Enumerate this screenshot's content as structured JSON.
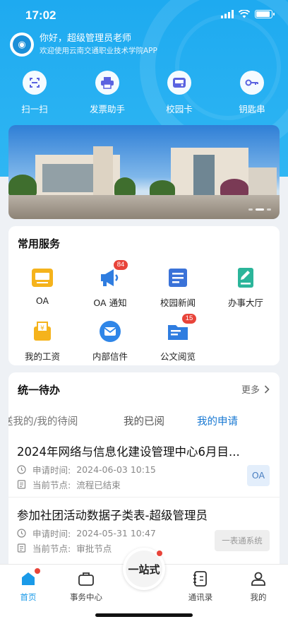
{
  "status": {
    "time": "17:02"
  },
  "header": {
    "greeting": "你好，超级管理员老师",
    "welcome": "欢迎使用云南交通职业技术学院APP"
  },
  "quick_actions": [
    {
      "label": "扫一扫",
      "icon": "scan-icon"
    },
    {
      "label": "发票助手",
      "icon": "printer-icon"
    },
    {
      "label": "校园卡",
      "icon": "card-icon"
    },
    {
      "label": "钥匙串",
      "icon": "key-icon"
    }
  ],
  "banner": {
    "slides": 3,
    "active": 2
  },
  "services": {
    "title": "常用服务",
    "items": [
      {
        "label": "OA",
        "icon": "oa-icon",
        "color": "#f5b31c",
        "badge": ""
      },
      {
        "label": "OA 通知",
        "icon": "megaphone-icon",
        "color": "#2f7de0",
        "badge": "84"
      },
      {
        "label": "校园新闻",
        "icon": "newspaper-icon",
        "color": "#3a72d8",
        "badge": ""
      },
      {
        "label": "办事大厅",
        "icon": "pen-book-icon",
        "color": "#2bb59a",
        "badge": ""
      },
      {
        "label": "我的工资",
        "icon": "salary-icon",
        "color": "#f5b31c",
        "badge": ""
      },
      {
        "label": "内部信件",
        "icon": "mail-icon",
        "color": "#2f86e8",
        "badge": ""
      },
      {
        "label": "公文阅览",
        "icon": "folder-icon",
        "color": "#2f7de0",
        "badge": "15"
      }
    ]
  },
  "todo": {
    "title": "统一待办",
    "more": "更多",
    "tabs": [
      "送我的/我的待阅",
      "我的已阅",
      "我的申请"
    ],
    "active_tab": 2,
    "items": [
      {
        "title": "2024年网络与信息化建设管理中心6月目...",
        "time_label": "申请时间:",
        "time": "2024-06-03 10:15",
        "node_label": "当前节点:",
        "node": "流程已结束",
        "tag": "OA"
      },
      {
        "title": "参加社团活动数据子类表-超级管理员",
        "time_label": "申请时间:",
        "time": "2024-05-31 10:47",
        "node_label": "当前节点:",
        "node": "审批节点",
        "tag": "一表通系统"
      }
    ]
  },
  "tabbar": {
    "items": [
      "首页",
      "事务中心",
      "通讯录",
      "我的"
    ],
    "center": "一站式",
    "accent": "#1a9ae8"
  }
}
